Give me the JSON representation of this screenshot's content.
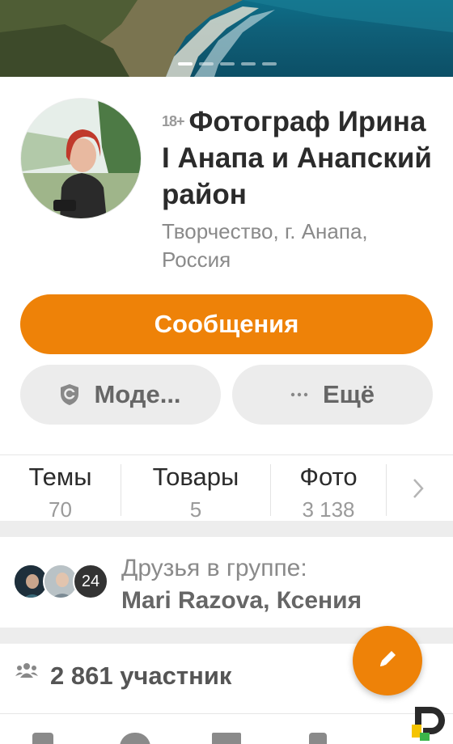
{
  "cover": {
    "slides_total": 5,
    "active_slide": 1
  },
  "group": {
    "age_rating": "18+",
    "title": "Фотограф Ирина I Анапа и Анапский район",
    "subtitle": "Творчество, г. Анапа, Россия"
  },
  "actions": {
    "primary": "Сообщения",
    "moderate": "Моде...",
    "more": "Ещё"
  },
  "tabs": [
    {
      "label": "Темы",
      "count": "70"
    },
    {
      "label": "Товары",
      "count": "5"
    },
    {
      "label": "Фото",
      "count": "3 138"
    }
  ],
  "friends": {
    "title": "Друзья в группе:",
    "names": "Mari Razova, Ксения",
    "extra_count": "24"
  },
  "members": {
    "text": "2 861 участник"
  },
  "colors": {
    "accent": "#ee8208",
    "secondary_bg": "#ececec",
    "text": "#2b2b2b",
    "muted": "#8a8a8a"
  }
}
